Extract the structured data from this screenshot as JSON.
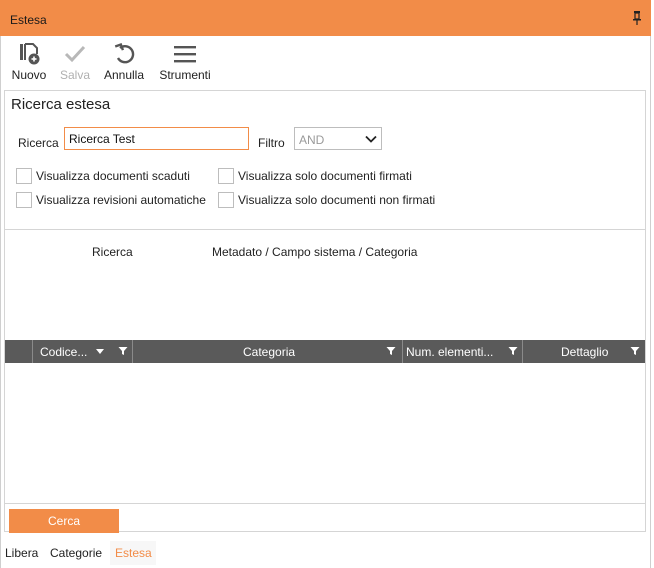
{
  "window": {
    "title": "Estesa",
    "pin_icon": "pin-icon"
  },
  "toolbar": {
    "nuovo": "Nuovo",
    "salva": "Salva",
    "annulla": "Annulla",
    "strumenti": "Strumenti"
  },
  "search": {
    "section_title": "Ricerca estesa",
    "ricerca_label": "Ricerca",
    "ricerca_value": "Ricerca Test",
    "filtro_label": "Filtro",
    "filtro_value": "AND",
    "options": [
      "Visualizza documenti scaduti",
      "Visualizza solo documenti firmati",
      "Visualizza revisioni automatiche",
      "Visualizza solo documenti non firmati"
    ]
  },
  "criteria": {
    "col_ricerca": "Ricerca",
    "col_metadato": "Metadato / Campo sistema / Categoria"
  },
  "grid": {
    "columns": [
      "Codice...",
      "Categoria",
      "Num. elementi...",
      "Dettaglio"
    ]
  },
  "actions": {
    "cerca": "Cerca"
  },
  "tabs": [
    "Libera",
    "Categorie",
    "Estesa"
  ],
  "colors": {
    "accent": "#f28c48",
    "grid_header": "#5a5a5a"
  }
}
